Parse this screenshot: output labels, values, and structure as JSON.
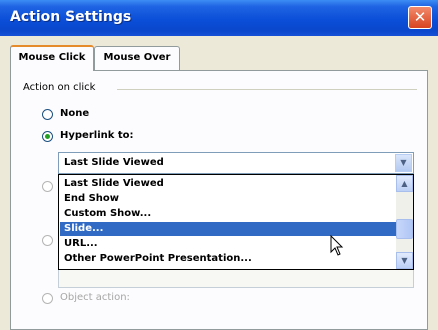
{
  "window": {
    "title": "Action Settings",
    "close_glyph": "✕"
  },
  "tabs": [
    {
      "label": "Mouse Click",
      "active": true
    },
    {
      "label": "Mouse Over",
      "active": false
    }
  ],
  "action_group": {
    "label": "Action on click",
    "options": {
      "none": "None",
      "hyperlink": "Hyperlink to:",
      "object_action": "Object action:"
    },
    "selected_option": "Hyperlink to:"
  },
  "hyperlink_combo": {
    "value": "Last Slide Viewed",
    "arrow_icon": "chevron-down-icon"
  },
  "dropdown": {
    "items": [
      "Last Slide Viewed",
      "End Show",
      "Custom Show...",
      "Slide...",
      "URL...",
      "Other PowerPoint Presentation..."
    ],
    "highlighted": "Slide..."
  },
  "colors": {
    "title_bar": "#0b4ed8",
    "selection": "#316ac5",
    "close_button": "#d8431f",
    "active_tab_accent": "#e68b2c"
  }
}
